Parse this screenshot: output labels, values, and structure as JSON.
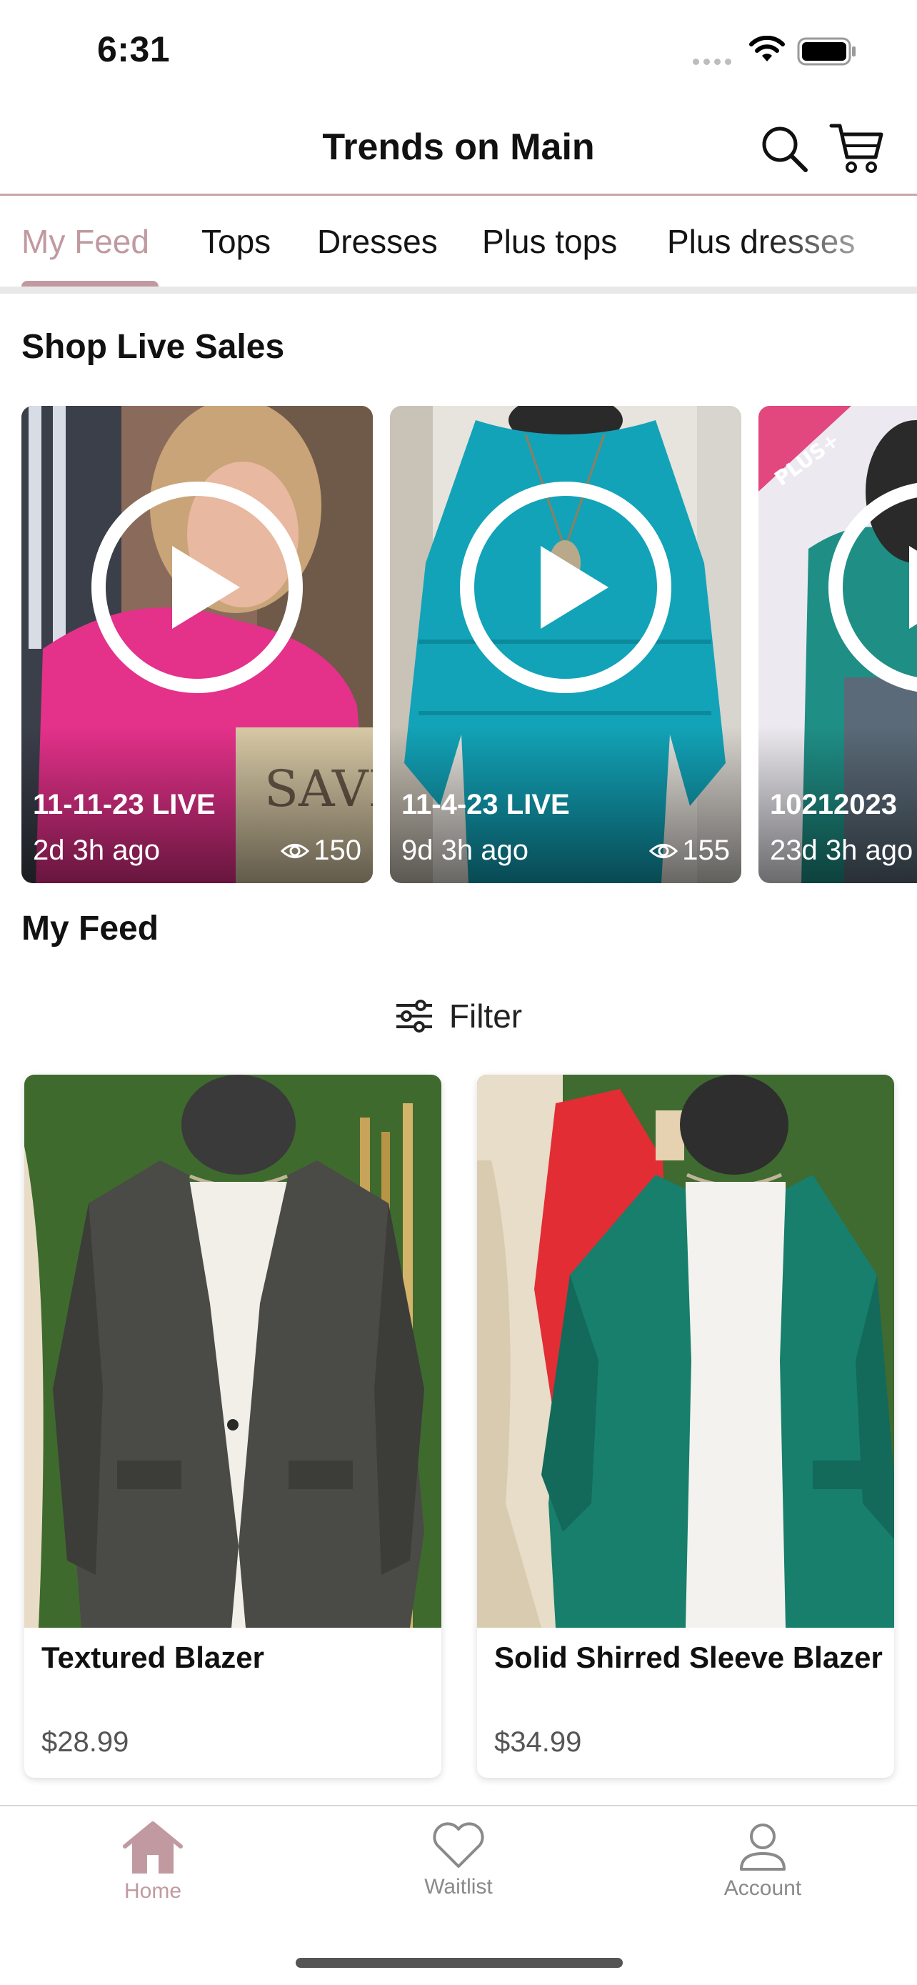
{
  "status_bar": {
    "time": "6:31"
  },
  "header": {
    "title": "Trends on Main",
    "search_icon": "search-icon",
    "cart_icon": "cart-icon"
  },
  "tabs": [
    {
      "label": "My Feed",
      "active": true
    },
    {
      "label": "Tops",
      "active": false
    },
    {
      "label": "Dresses",
      "active": false
    },
    {
      "label": "Plus tops",
      "active": false
    },
    {
      "label": "Plus dresses",
      "active": false
    }
  ],
  "live_section": {
    "title": "Shop Live Sales",
    "items": [
      {
        "title": "11-11-23 LIVE",
        "ago": "2d 3h ago",
        "views": "150"
      },
      {
        "title": "11-4-23 LIVE",
        "ago": "9d 3h ago",
        "views": "155"
      },
      {
        "title": "10212023",
        "ago": "23d 3h ago",
        "views": "",
        "badge": "PLUS+"
      }
    ]
  },
  "feed": {
    "title": "My Feed",
    "filter_label": "Filter",
    "products": [
      {
        "name": "Textured Blazer",
        "price": "$28.99"
      },
      {
        "name": "Solid Shirred Sleeve Blazer",
        "price": "$34.99"
      }
    ]
  },
  "bottom_nav": [
    {
      "label": "Home",
      "icon": "home-icon",
      "active": true
    },
    {
      "label": "Waitlist",
      "icon": "heart-icon",
      "active": false
    },
    {
      "label": "Account",
      "icon": "account-icon",
      "active": false
    }
  ],
  "colors": {
    "accent": "#c09aa0",
    "divider": "#c9a6aa",
    "inactive": "#8a8a8a"
  }
}
